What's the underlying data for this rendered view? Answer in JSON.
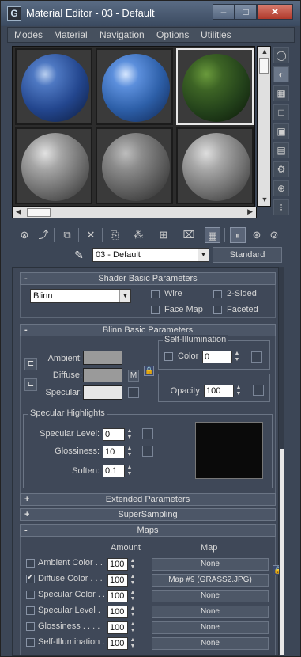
{
  "window": {
    "title": "Material Editor - 03 - Default",
    "app_icon": "G",
    "buttons": {
      "minimize": "–",
      "maximize": "□",
      "close": "✕"
    }
  },
  "menu": [
    "Modes",
    "Material",
    "Navigation",
    "Options",
    "Utilities"
  ],
  "slots": [
    {
      "material": "blue-ice",
      "color": "#2b4a84",
      "selected": false
    },
    {
      "material": "earth-blue",
      "color": "#2d5fa8",
      "selected": false
    },
    {
      "material": "grass",
      "color": "#2c4a1c",
      "selected": true
    },
    {
      "material": "default-grey",
      "color": "#8a8a8a",
      "selected": false
    },
    {
      "material": "concrete",
      "color": "#6e6e6e",
      "selected": false
    },
    {
      "material": "wood-grey",
      "color": "#8c8c8c",
      "selected": false
    }
  ],
  "side_tools": [
    "sample-type-icon",
    "backlight-icon",
    "background-icon",
    "uv-tiling-icon",
    "video-check-icon",
    "preview-icon",
    "options-icon",
    "select-by-material-icon",
    "material-navigator-icon"
  ],
  "bottom_tools": [
    "get-material-icon",
    "put-to-scene-icon",
    "assign-material-icon",
    "reset-map-icon",
    "copy-material-icon",
    "make-unique-icon",
    "put-to-library-icon",
    "material-id-icon",
    "show-map-icon",
    "show-end-result-icon",
    "go-to-parent-icon",
    "go-forward-icon"
  ],
  "material_name": "03 - Default",
  "material_type": "Standard",
  "shader_basic": {
    "header": "Shader Basic Parameters",
    "sign": "-",
    "shader": "Blinn",
    "wire": "Wire",
    "two_sided": "2-Sided",
    "face_map": "Face Map",
    "faceted": "Faceted"
  },
  "blinn_basic": {
    "header": "Blinn Basic Parameters",
    "sign": "-",
    "ambient": "Ambient:",
    "diffuse": "Diffuse:",
    "specular": "Specular:",
    "m_button": "M",
    "self_illum_title": "Self-Illumination",
    "color_label": "Color",
    "color_value": "0",
    "opacity_label": "Opacity:",
    "opacity_value": "100",
    "colors": {
      "ambient": "#9a9a9a",
      "diffuse": "#9a9a9a",
      "specular": "#e6e6e6"
    }
  },
  "specular_highlights": {
    "title": "Specular Highlights",
    "level_label": "Specular Level:",
    "level_value": "0",
    "gloss_label": "Glossiness:",
    "gloss_value": "10",
    "soften_label": "Soften:",
    "soften_value": "0.1"
  },
  "rollouts": [
    {
      "sign": "+",
      "label": "Extended Parameters"
    },
    {
      "sign": "+",
      "label": "SuperSampling"
    },
    {
      "sign": "-",
      "label": "Maps"
    }
  ],
  "maps": {
    "amount_header": "Amount",
    "map_header": "Map",
    "rows": [
      {
        "label": "Ambient Color . .",
        "amount": "100",
        "map": "None",
        "checked": false
      },
      {
        "label": "Diffuse Color . . .",
        "amount": "100",
        "map": "Map #9 (GRASS2.JPG)",
        "checked": true
      },
      {
        "label": "Specular Color . .",
        "amount": "100",
        "map": "None",
        "checked": false
      },
      {
        "label": "Specular Level  .",
        "amount": "100",
        "map": "None",
        "checked": false
      },
      {
        "label": "Glossiness  . . . .",
        "amount": "100",
        "map": "None",
        "checked": false
      },
      {
        "label": "Self-Illumination .",
        "amount": "100",
        "map": "None",
        "checked": false
      }
    ]
  },
  "colors": {
    "window_bg": "#3c4656",
    "panel_bg": "#3f4858",
    "selected_slot_border": "#e8e8e8"
  }
}
